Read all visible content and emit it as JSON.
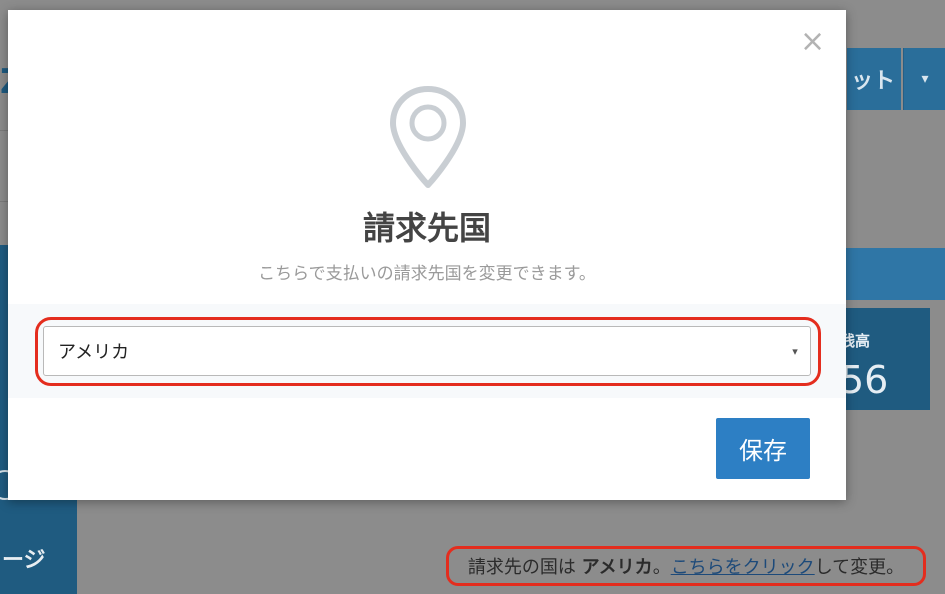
{
  "background": {
    "top_button_label": "ット",
    "top_button_caret": "▾",
    "left_tab_label": "ージ",
    "left_edge_letter": "Z",
    "card": {
      "label": "残高",
      "value": "56"
    },
    "billing_status": {
      "prefix": "請求先の国は",
      "country": "アメリカ",
      "punct": "。",
      "link": "こちらをクリック",
      "suffix": "して変更。"
    }
  },
  "modal": {
    "close_glyph": "×",
    "icon": "map-pin-icon",
    "title": "請求先国",
    "subtitle": "こちらで支払いの請求先国を変更できます。",
    "select": {
      "value": "アメリカ",
      "caret": "▾"
    },
    "save_label": "保存"
  },
  "colors": {
    "accent": "#2d7fc4",
    "dark_blue": "#1f5b80",
    "highlight_red": "#e42d1e",
    "overlay_gray": "#8c8c8c"
  }
}
